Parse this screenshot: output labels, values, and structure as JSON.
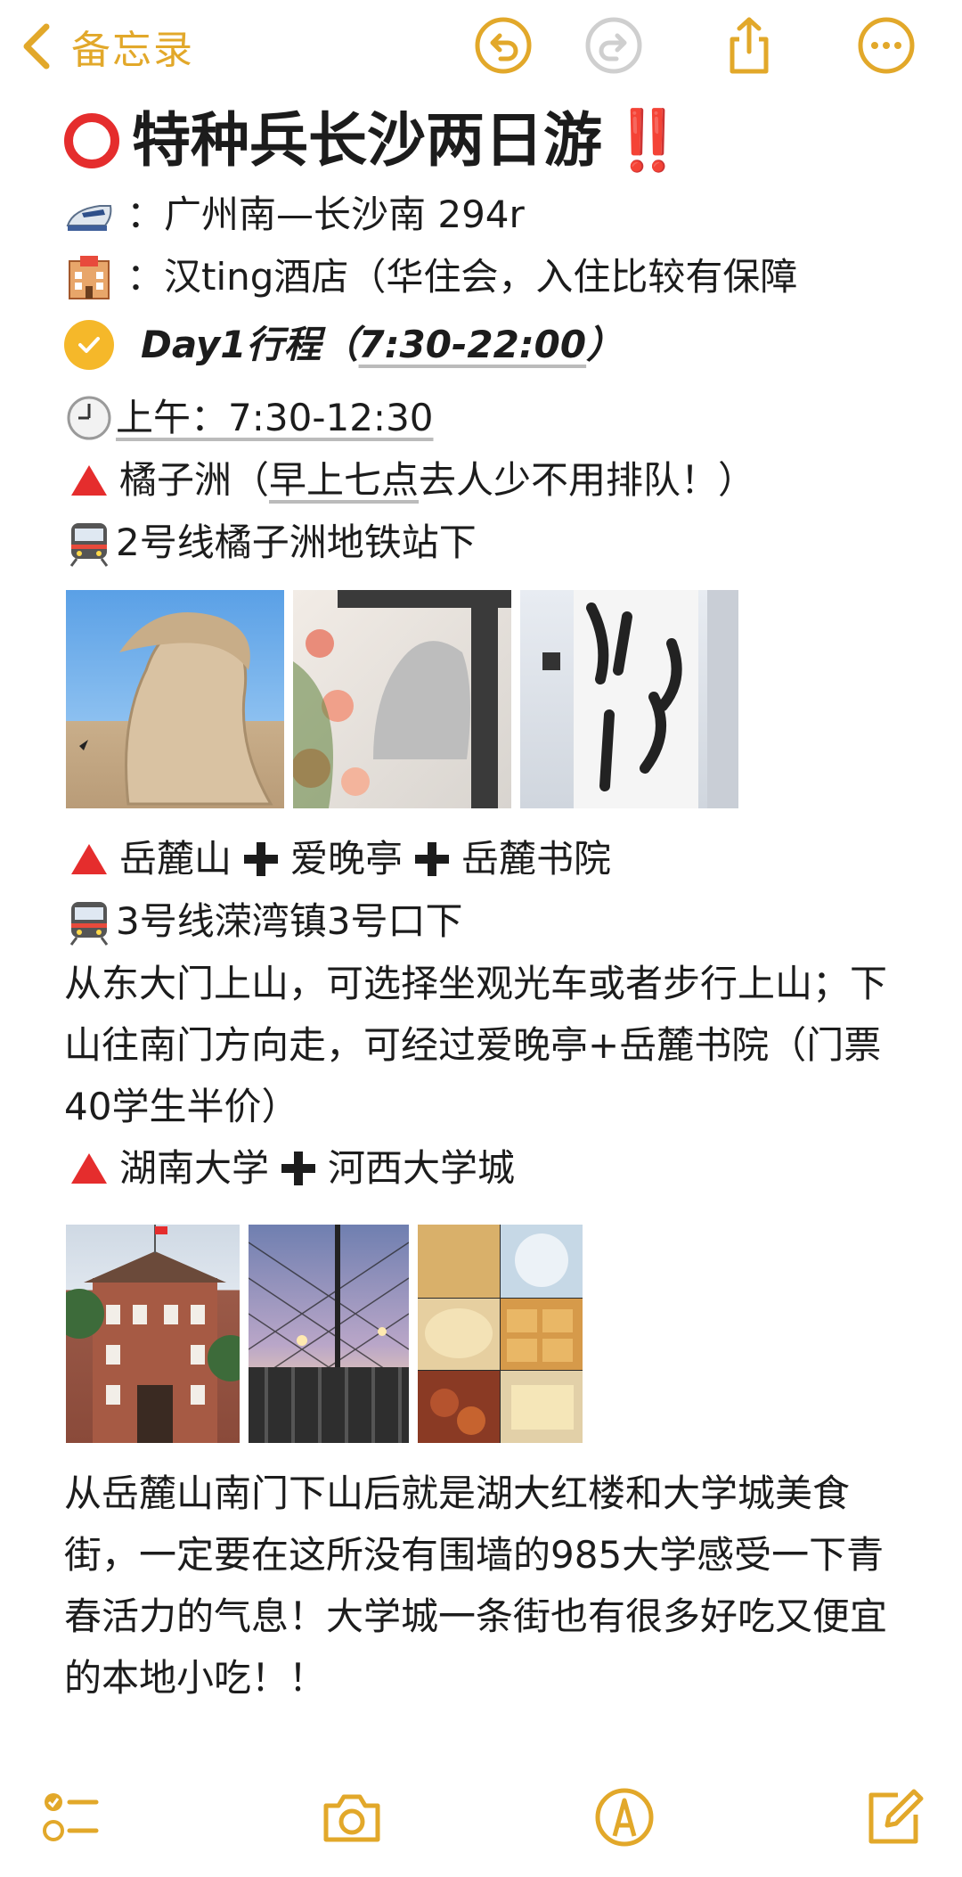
{
  "nav": {
    "back_label": "备忘录"
  },
  "toolbar": {
    "icons": [
      "undo-icon",
      "redo-icon",
      "share-icon",
      "more-icon"
    ],
    "accent": "#e2a82a"
  },
  "note": {
    "title": "特种兵长沙两日游",
    "title_suffix": "‼️",
    "train_line": "：广州南—长沙南 294r",
    "hotel_line": "：汉ting酒店（华住会，入住比较有保障",
    "day_title": "Day1行程",
    "day_time_open": "（",
    "day_time": "7:30-22:00",
    "day_time_close": "）",
    "morning": "上午：7:30-12:30",
    "spot1_name": "橘子洲（",
    "spot1_note_u": "早上七点",
    "spot1_note_rest": "去人少不用排队！）",
    "subway1": "2号线橘子洲地铁站下",
    "spot2_a": "岳麓山",
    "spot2_b": "爱晚亭",
    "spot2_c": "岳麓书院",
    "subway2": "3号线溁湾镇3号口下",
    "para1": "从东大门上山，可选择坐观光车或者步行上山；下山往南门方向走，可经过爱晚亭+岳麓书院（门票40学生半价）",
    "spot3_a": "湖南大学",
    "spot3_b": "河西大学城",
    "para2": "从岳麓山南门下山后就是湖大红楼和大学城美食街，一定要在这所没有围墙的985大学感受一下青春活力的气息！大学城一条街也有很多好吃又便宜的本地小吃！！"
  },
  "bottom_toolbar": {
    "icons": [
      "checklist-icon",
      "camera-icon",
      "markup-pen-icon",
      "compose-icon"
    ]
  },
  "colors": {
    "accent": "#e2a82a",
    "red": "#e52d2d",
    "check": "#f5b82a"
  }
}
